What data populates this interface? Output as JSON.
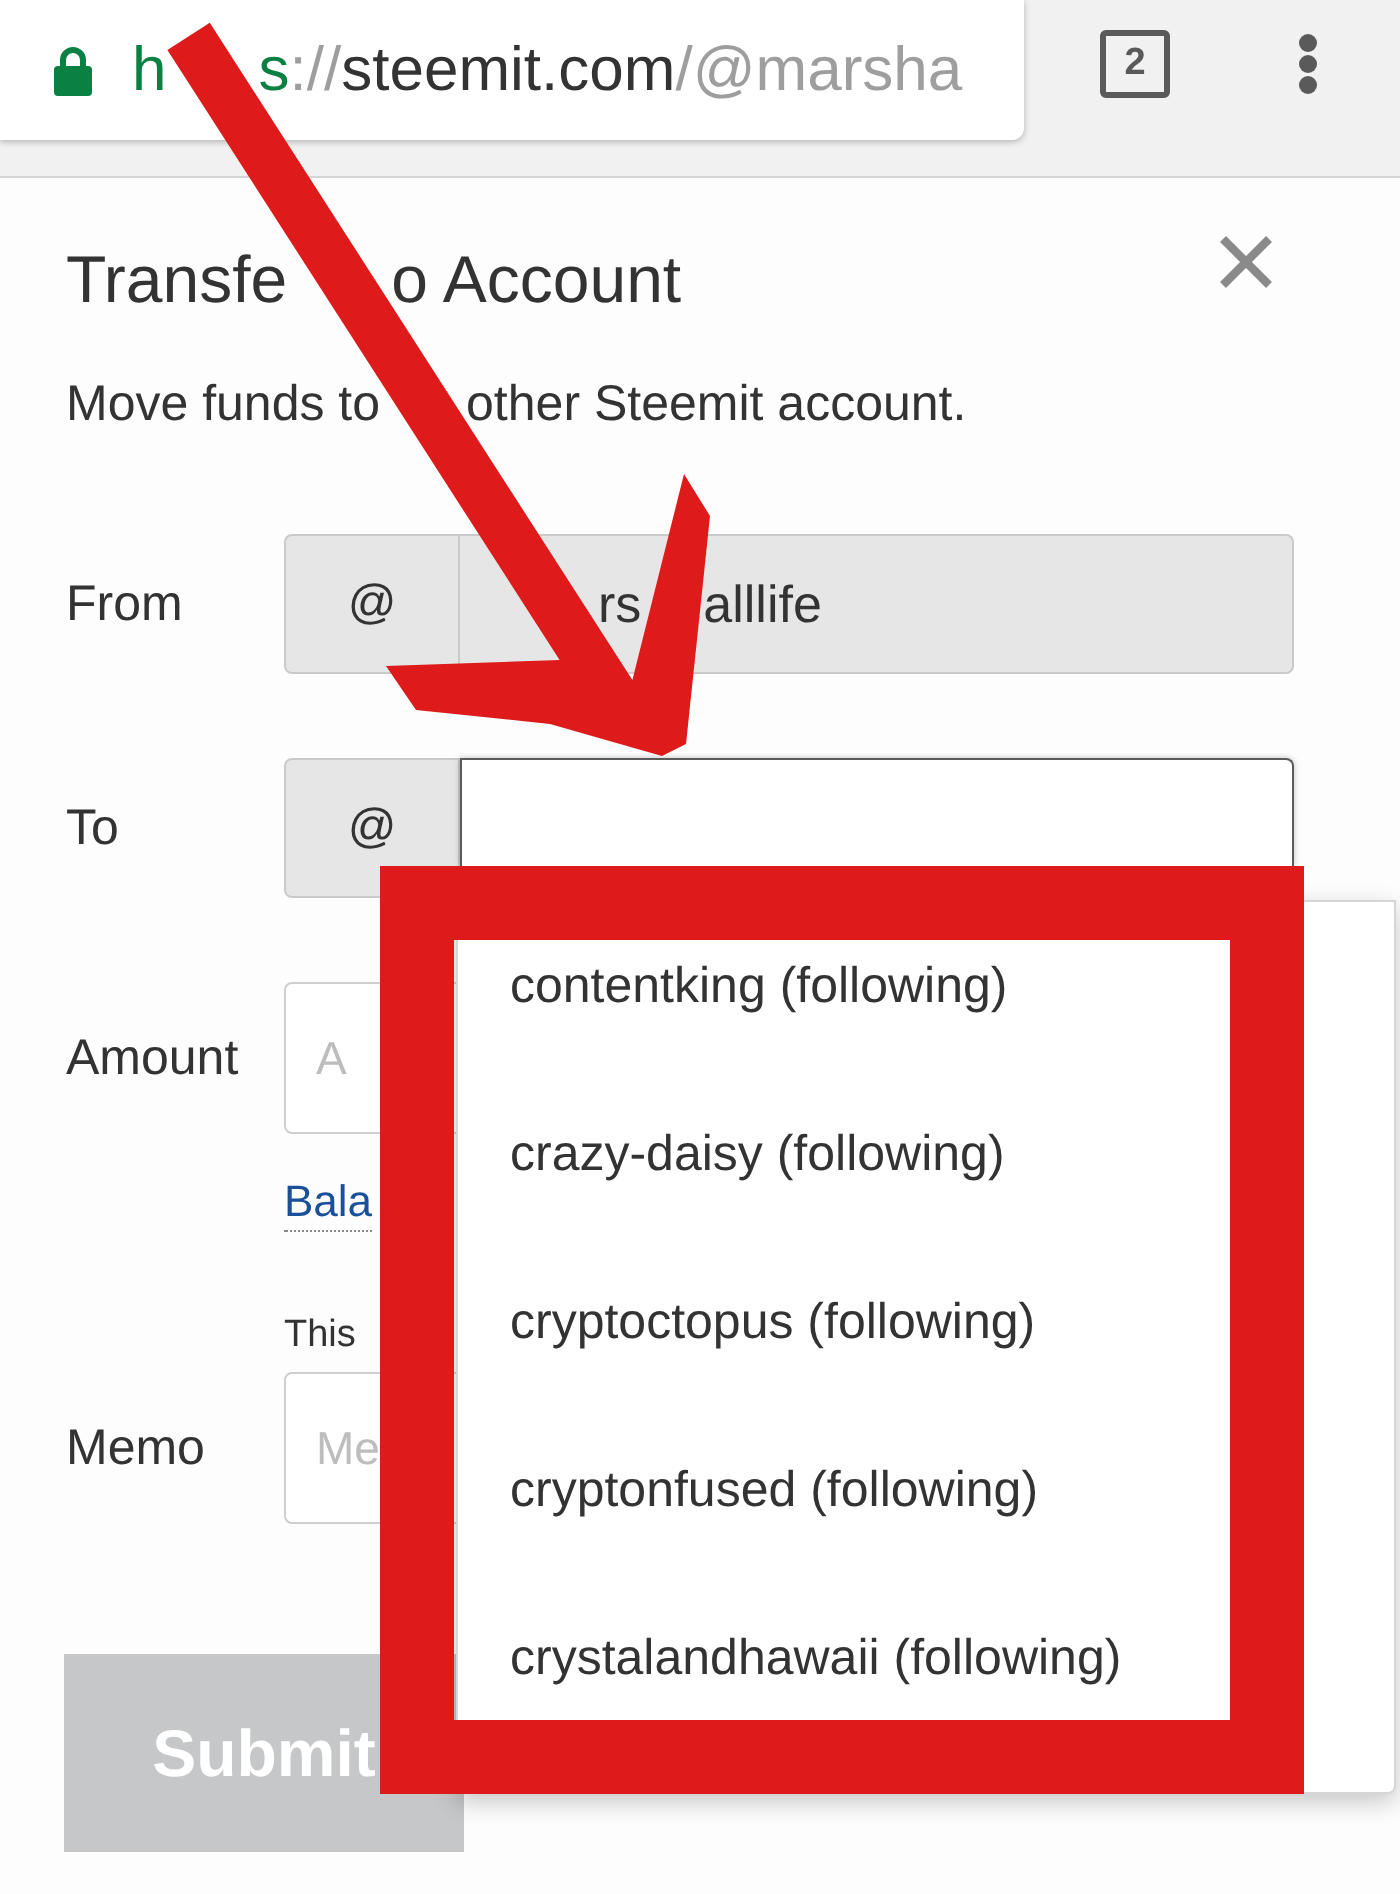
{
  "browser": {
    "secure": true,
    "url": [
      [
        {
          "kind": "scheme",
          "text": "h"
        }
      ],
      [
        {
          "kind": "scheme",
          "text": "s"
        },
        {
          "kind": "separator",
          "text": "://"
        },
        {
          "kind": "host",
          "text": "steemit.com"
        },
        {
          "kind": "path",
          "text": "/@marsha"
        }
      ]
    ],
    "tab_count": "2"
  },
  "dialog": {
    "title": [
      "Transfe",
      "o Account"
    ],
    "description": [
      "Move funds to",
      "other Steemit account."
    ],
    "rows": [
      {
        "kind": "account",
        "label": "From",
        "prefix": "@",
        "value": [
          "rs",
          "alllife"
        ],
        "disabled": true,
        "focused": false
      },
      {
        "kind": "account",
        "label": "To",
        "prefix": "@",
        "disabled": false,
        "focused": true
      },
      {
        "kind": "text",
        "label": "Amount",
        "placeholder": "A",
        "link": "Bala"
      },
      {
        "kind": "text",
        "label": "Memo",
        "hint": "This",
        "placeholder": "Me"
      }
    ],
    "submit": {
      "label": "Submit",
      "disabled": true
    }
  },
  "suggestions": [
    "contentking (following)",
    "crazy-daisy (following)",
    "cryptoctopus (following)",
    "cryptonfused (following)",
    "crystalandhawaii (following)"
  ],
  "annotations": {
    "arrow": true,
    "highlight_frame": true
  }
}
